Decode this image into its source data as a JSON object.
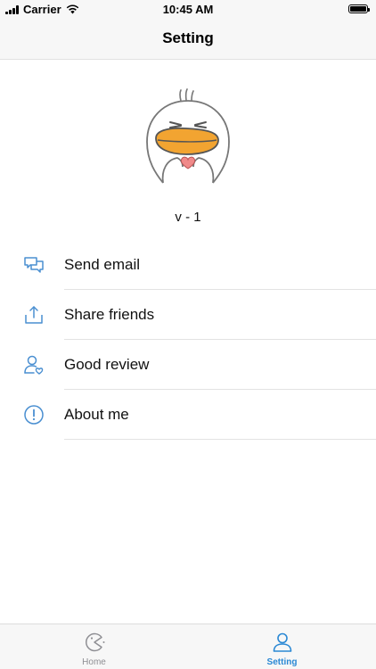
{
  "status_bar": {
    "carrier": "Carrier",
    "time": "10:45 AM"
  },
  "nav": {
    "title": "Setting"
  },
  "version": "v - 1",
  "menu": {
    "items": [
      {
        "label": "Send email",
        "icon": "chat-bubbles-icon"
      },
      {
        "label": "Share friends",
        "icon": "share-icon"
      },
      {
        "label": "Good review",
        "icon": "user-heart-icon"
      },
      {
        "label": "About me",
        "icon": "info-icon"
      }
    ]
  },
  "tab_bar": {
    "tabs": [
      {
        "label": "Home",
        "icon": "pacman-icon",
        "active": false
      },
      {
        "label": "Setting",
        "icon": "user-icon",
        "active": true
      }
    ]
  },
  "colors": {
    "accent": "#2a88d4",
    "icon": "#4a8fd1",
    "inactive": "#8e8e93",
    "beak": "#f2a431"
  }
}
